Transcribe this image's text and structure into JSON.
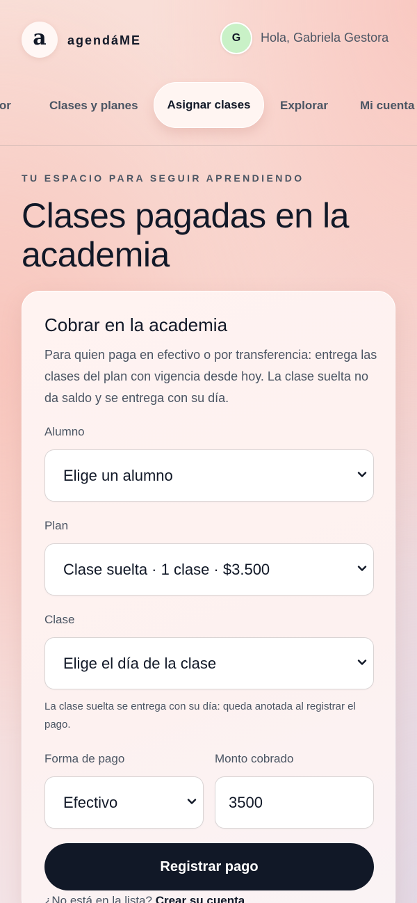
{
  "app": {
    "brand_mark": "a",
    "brand_name": "agendáME"
  },
  "user": {
    "initial": "G",
    "greeting": "Hola, Gabriela Gestora"
  },
  "nav": {
    "items": [
      "esor",
      "Clases y planes",
      "Asignar clases",
      "Explorar",
      "Mi cuenta"
    ],
    "active": "Asignar clases"
  },
  "hero": {
    "eyebrow": "TU ESPACIO PARA SEGUIR APRENDIENDO",
    "title": "Clases pagadas en la academia"
  },
  "form": {
    "title": "Cobrar en la academia",
    "description": "Para quien paga en efectivo o por transferencia: entrega las clases del plan con vigencia desde hoy. La clase suelta no da saldo y se entrega con su día.",
    "student_label": "Alumno",
    "student_value": "Elige un alumno",
    "plan_label": "Plan",
    "plan_value": "Clase suelta · 1 clase · $3.500",
    "class_label": "Clase",
    "class_value": "Elige el día de la clase",
    "class_hint": "La clase suelta se entrega con su día: queda anotada al registrar el pago.",
    "payment_label": "Forma de pago",
    "payment_value": "Efectivo",
    "amount_label": "Monto cobrado",
    "amount_value": "3500",
    "submit_label": "Registrar pago",
    "footer_text": "¿No está en la lista?",
    "footer_link": "Crear su cuenta"
  },
  "colors": {
    "primary_button": "#111827",
    "avatar_bg": "#c9f1c7"
  },
  "icons": [
    "chevron-down-icon"
  ]
}
